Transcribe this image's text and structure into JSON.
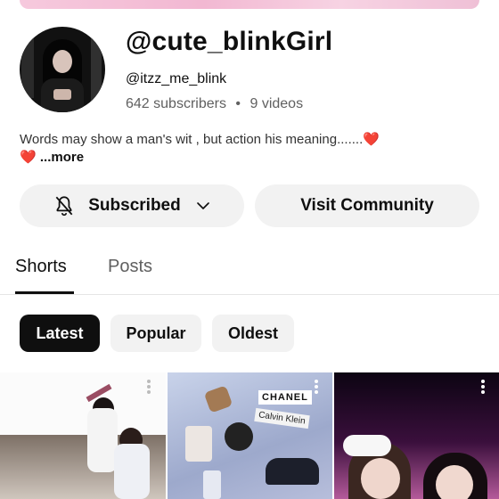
{
  "channel": {
    "name": "@cute_blinkGirl",
    "handle": "@itzz_me_blink",
    "subscribers": "642 subscribers",
    "separator": "•",
    "videos": "9 videos",
    "description": "Words may show a man's wit , but action his meaning.......",
    "heart_emoji": "❤️",
    "more_label": "...more"
  },
  "actions": {
    "subscribed_label": "Subscribed",
    "visit_label": "Visit Community"
  },
  "tabs": [
    {
      "label": "Shorts",
      "active": true
    },
    {
      "label": "Posts",
      "active": false
    }
  ],
  "filters": [
    {
      "label": "Latest",
      "selected": true
    },
    {
      "label": "Popular",
      "selected": false
    },
    {
      "label": "Oldest",
      "selected": false
    }
  ],
  "thumbnails": [
    {
      "brand_text": ""
    },
    {
      "brand_text": "CHANEL",
      "brand_text_2": "Calvin Klein"
    },
    {
      "brand_text": ""
    }
  ],
  "colors": {
    "accent_dark": "#0f0f0f",
    "chip_bg": "#f2f2f2",
    "secondary_text": "#606060",
    "heart": "#e0202c"
  },
  "icons": {
    "bell": "bell-off-icon",
    "chevron": "chevron-down-icon",
    "more": "more-vert-icon"
  }
}
